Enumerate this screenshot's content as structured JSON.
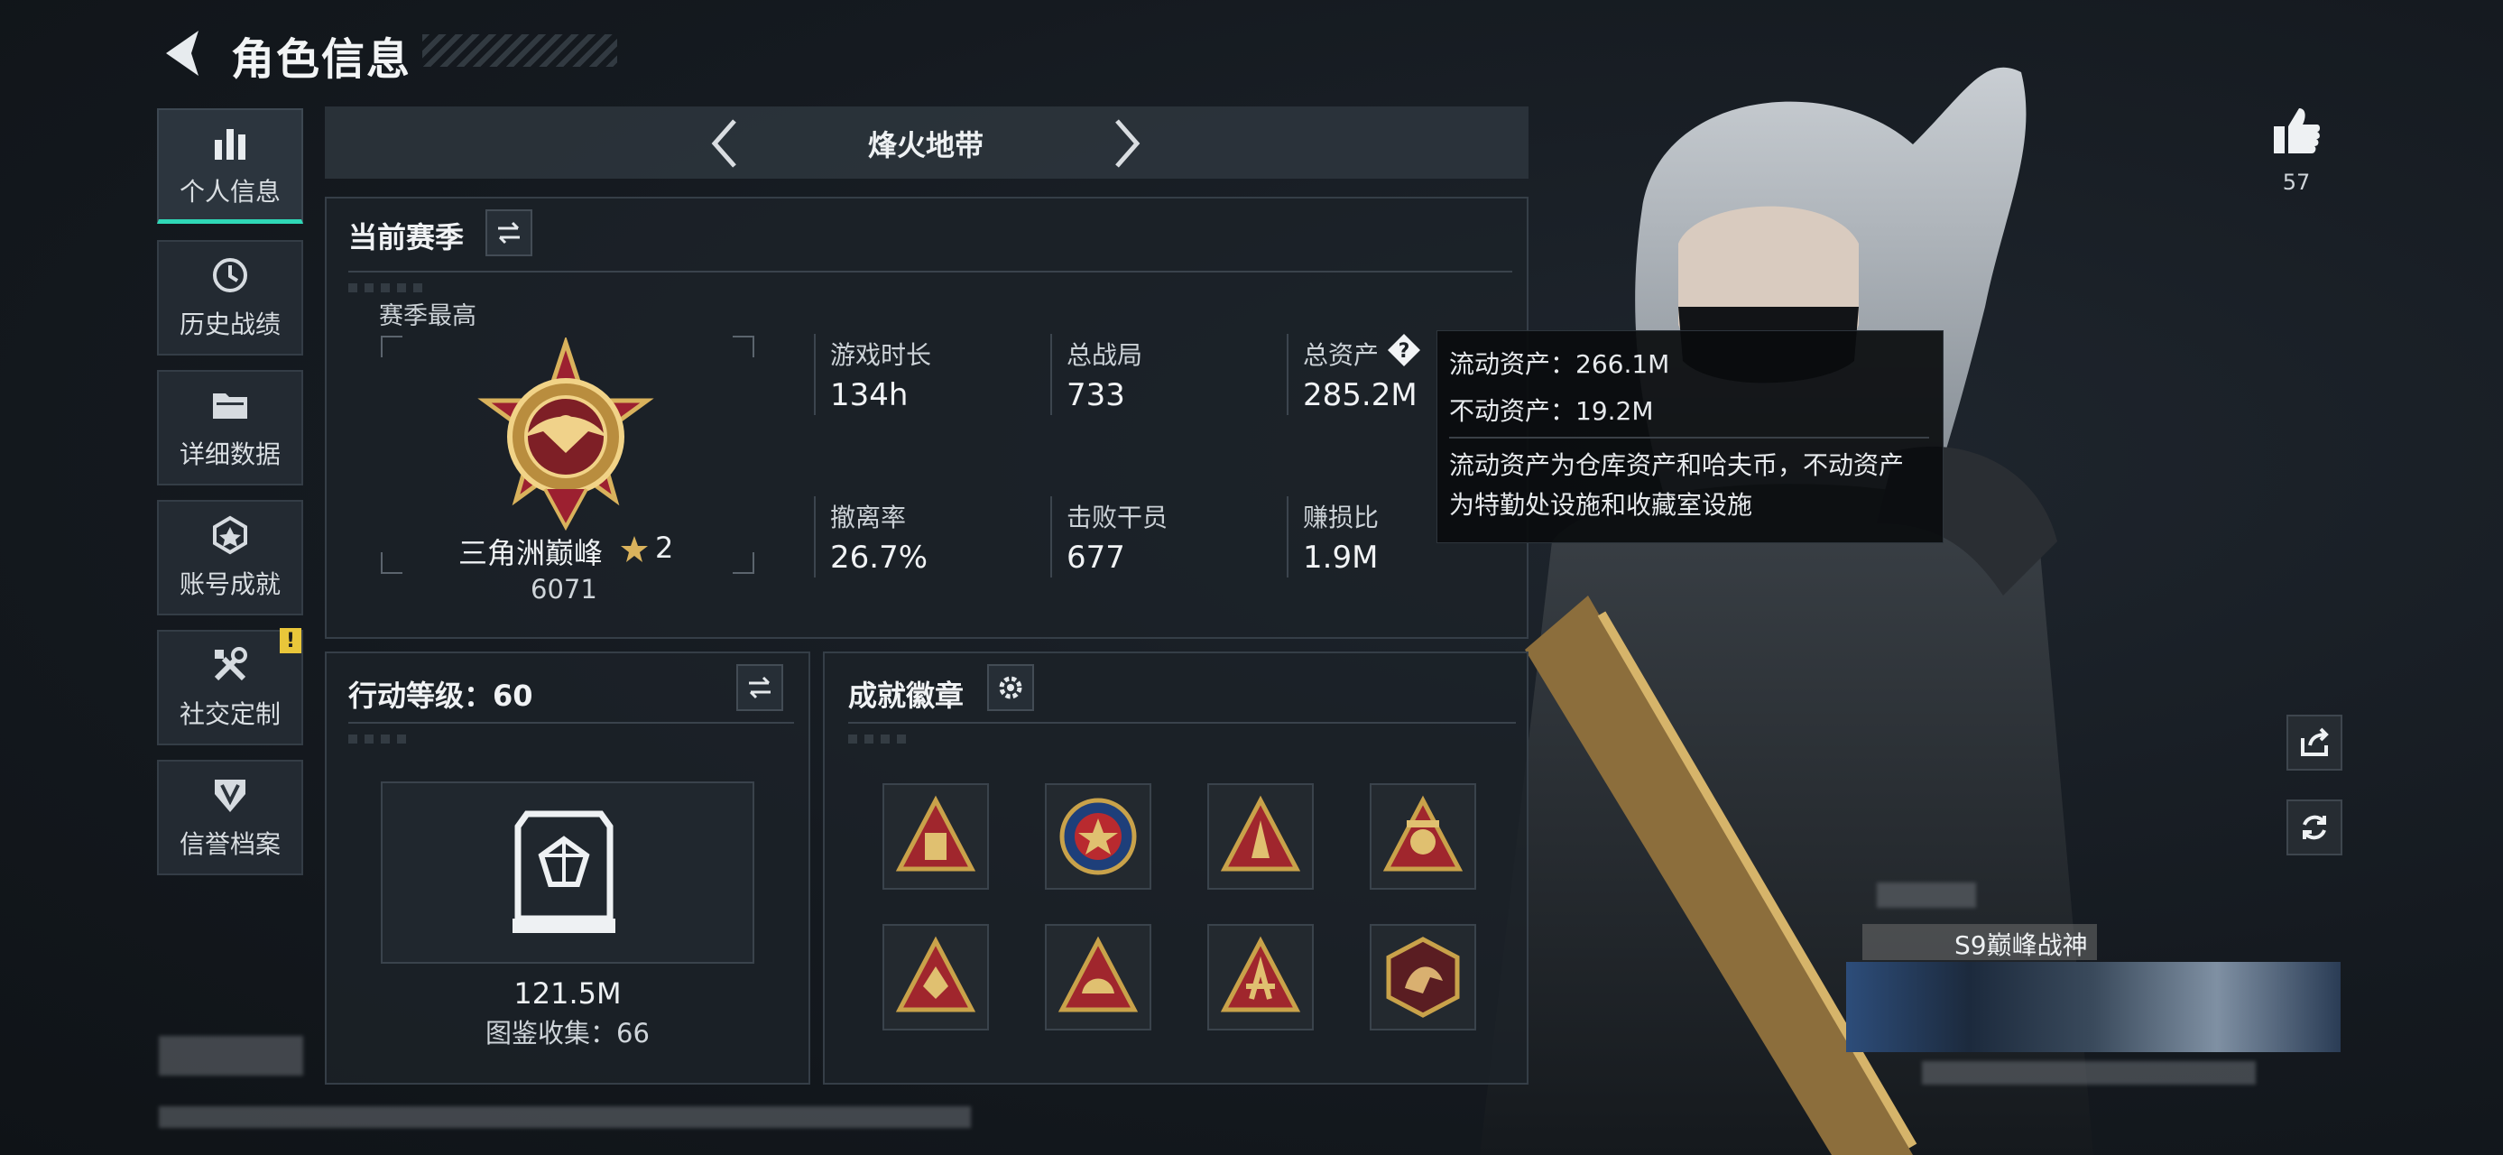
{
  "header": {
    "title": "角色信息"
  },
  "sidebar": {
    "items": [
      {
        "label": "个人信息",
        "active": true,
        "icon": "bar-chart-icon"
      },
      {
        "label": "历史战绩",
        "active": false,
        "icon": "history-clock-icon"
      },
      {
        "label": "详细数据",
        "active": false,
        "icon": "folder-icon"
      },
      {
        "label": "账号成就",
        "active": false,
        "icon": "medal-icon"
      },
      {
        "label": "社交定制",
        "active": false,
        "icon": "tools-icon",
        "badge": "!"
      },
      {
        "label": "信誉档案",
        "active": false,
        "icon": "shield-icon"
      }
    ]
  },
  "mode": {
    "title": "烽火地带"
  },
  "season": {
    "title": "当前赛季",
    "best_label": "赛季最高",
    "rank_name": "三角洲巅峰",
    "rank_stars": "2",
    "rank_points": "6071",
    "stats": [
      {
        "label": "游戏时长",
        "value": "134h"
      },
      {
        "label": "总战局",
        "value": "733"
      },
      {
        "label": "总资产",
        "value": "285.2M"
      },
      {
        "label": "撤离率",
        "value": "26.7%"
      },
      {
        "label": "击败干员",
        "value": "677"
      },
      {
        "label": "赚损比",
        "value": "1.9M"
      }
    ]
  },
  "tooltip": {
    "liquid": "流动资产：266.1M",
    "fixed": "不动资产：19.2M",
    "desc_line1": "流动资产为仓库资产和哈夫币，不动资产",
    "desc_line2": "为特勤处设施和收藏室设施"
  },
  "action_level": {
    "title": "行动等级：60",
    "value": "121.5M",
    "collection": "图鉴收集：66"
  },
  "achievements": {
    "title": "成就徽章",
    "badges": [
      "badge-1-icon",
      "badge-2-icon",
      "badge-3-icon",
      "badge-4-icon",
      "badge-5-icon",
      "badge-6-icon",
      "badge-7-icon",
      "badge-8-icon"
    ]
  },
  "likes": {
    "count": "57"
  },
  "player_card": {
    "title": "S9巅峰战神"
  },
  "colors": {
    "accent": "#2fd8b7",
    "gold": "#c9a24a",
    "warning": "#e9c63a"
  }
}
